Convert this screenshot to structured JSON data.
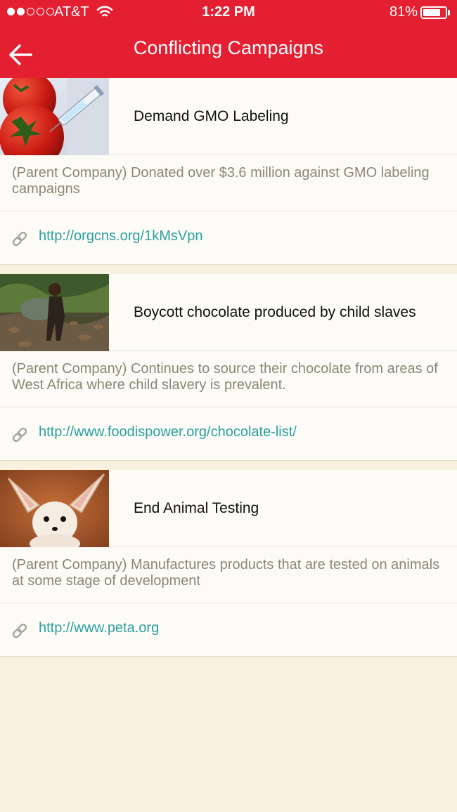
{
  "status_bar": {
    "carrier": "AT&T",
    "time": "1:22 PM",
    "battery": "81%",
    "battery_level": 0.81,
    "signal_bars": 2,
    "signal_total": 5
  },
  "header": {
    "title": "Conflicting Campaigns",
    "back_icon": "arrow-left-icon",
    "color": "#e41f31"
  },
  "campaigns": [
    {
      "title": "Demand GMO Labeling",
      "description": "(Parent Company) Donated over $3.6 million against GMO labeling campaigns",
      "link": "http://orgcns.org/1kMsVpn",
      "image": "tomatoes-syringe"
    },
    {
      "title": "Boycott chocolate produced by child slaves",
      "description": "(Parent Company) Continues to source their chocolate from areas of West Africa where child slavery is prevalent.",
      "link": "http://www.foodispower.org/chocolate-list/",
      "image": "child-carrying-sack"
    },
    {
      "title": "End Animal Testing",
      "description": "(Parent Company) Manufactures products that are tested on animals at some stage of development",
      "link": "http://www.peta.org",
      "image": "fennec-fox"
    }
  ],
  "colors": {
    "link": "#2aa1a2",
    "description": "#8d8676",
    "background": "#f8f1df"
  }
}
